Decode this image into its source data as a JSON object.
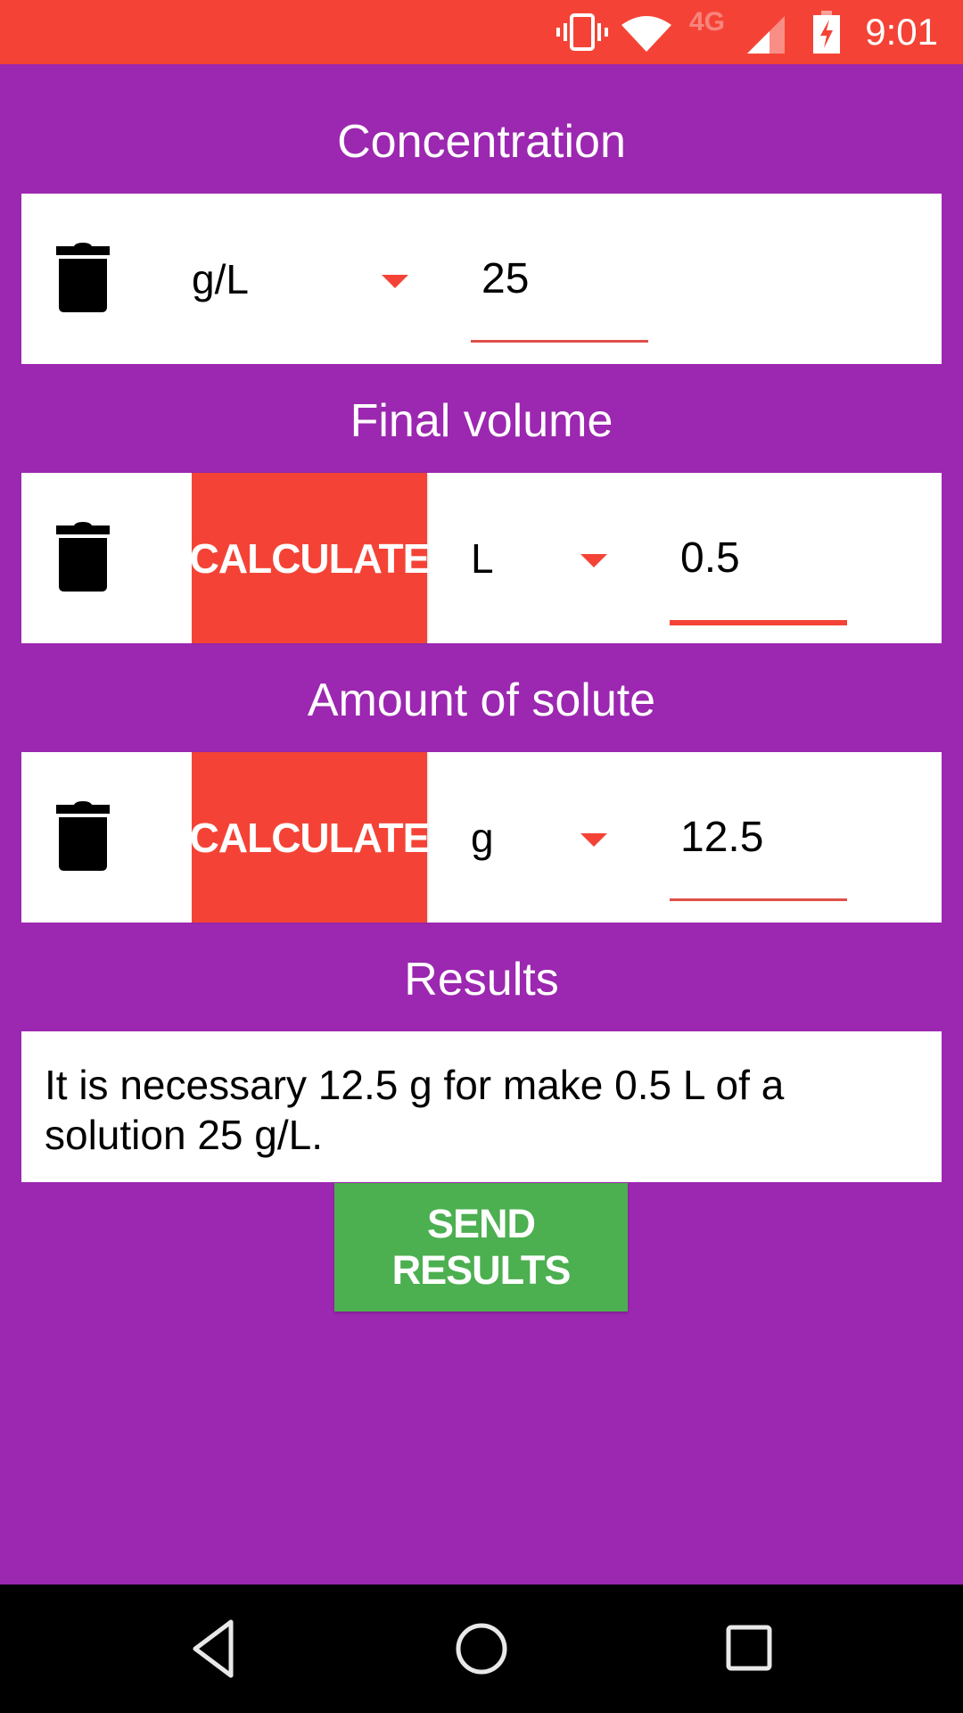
{
  "status_bar": {
    "time": "9:01",
    "network_label": "4G",
    "icons": [
      "vibrate-icon",
      "wifi-icon",
      "cellular-signal-icon",
      "battery-charging-icon"
    ],
    "background_color": "#F44336"
  },
  "theme": {
    "page_background": "#9C27B0",
    "accent": "#F44336",
    "send_button_color": "#4CAF50"
  },
  "sections": {
    "concentration": {
      "title": "Concentration",
      "unit": "g/L",
      "value": "25",
      "has_calculate": false
    },
    "final_volume": {
      "title": "Final volume",
      "calculate_label": "CALCULATE",
      "unit": "L",
      "value": "0.5",
      "focused": true
    },
    "amount_of_solute": {
      "title": "Amount of solute",
      "calculate_label": "CALCULATE",
      "unit": "g",
      "value": "12.5"
    }
  },
  "results": {
    "title": "Results",
    "text": "It is necessary 12.5 g for make 0.5 L of a solution 25 g/L.",
    "send_label": "SEND RESULTS"
  },
  "nav_bar": {
    "buttons": [
      "back",
      "home",
      "recents"
    ]
  }
}
